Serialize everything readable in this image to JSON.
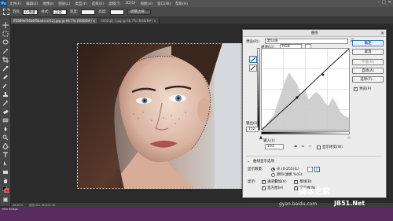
{
  "app": {
    "logo": "Ps",
    "menu": [
      "文件(F)",
      "编辑(E)",
      "图像(I)",
      "图层(L)",
      "类型(Y)",
      "选择(S)",
      "滤镜(T)",
      "3D(D)",
      "视图(V)",
      "窗口(W)",
      "帮助(H)"
    ],
    "window_controls": [
      "–",
      "□",
      "✕"
    ]
  },
  "options": {
    "feather_label": "羽化",
    "feather_value": "0 像素",
    "style_label": "样式:",
    "style_value": "正常",
    "width_label": "宽度:",
    "height_label": "高度:",
    "refine_button": "调整边缘..."
  },
  "tabs": [
    {
      "label": "ff3889ef36b6f6ba4cccf12j.jpg @ 66.7% (RGB/8#) ×",
      "active": true
    },
    {
      "label": "3052q0_t.jpg @ 66.7% (RGB/8#) ×",
      "active": false
    }
  ],
  "status": {
    "zoom": "66.67%",
    "doc": "文档:451.9K/451.9K",
    "bottom": "Mini Bridge"
  },
  "curves": {
    "title": "曲线",
    "preset_label": "预设(R):",
    "preset_value": "默认值",
    "channel_label": "通道(C):",
    "channel_value": "RGB",
    "buttons": {
      "ok": "确定",
      "cancel": "取消",
      "smooth": "平滑(M)",
      "auto": "自动(A)",
      "options": "选项(T)..."
    },
    "preview_label": "预览(P)",
    "output_label": "输出(O):",
    "output_value": "152",
    "input_label": "输入(I):",
    "input_value": "103",
    "show_clipping": "显示修剪(W)",
    "display_options": "曲线显示选项",
    "show_amount_label": "显示数量:",
    "show_light": "光 (0-255)(L)",
    "show_ink": "颜料/油墨 %(G)",
    "show_label": "显示:",
    "checks": {
      "channel_overlays": "通道叠加(V)",
      "baseline": "基线(B)",
      "histogram": "直方图(H)",
      "intersection": "交叉线(N)"
    }
  },
  "watermark": {
    "line1": "脚本之家",
    "line2": "JB51.Net",
    "line3": "gyan.baidu.com"
  }
}
